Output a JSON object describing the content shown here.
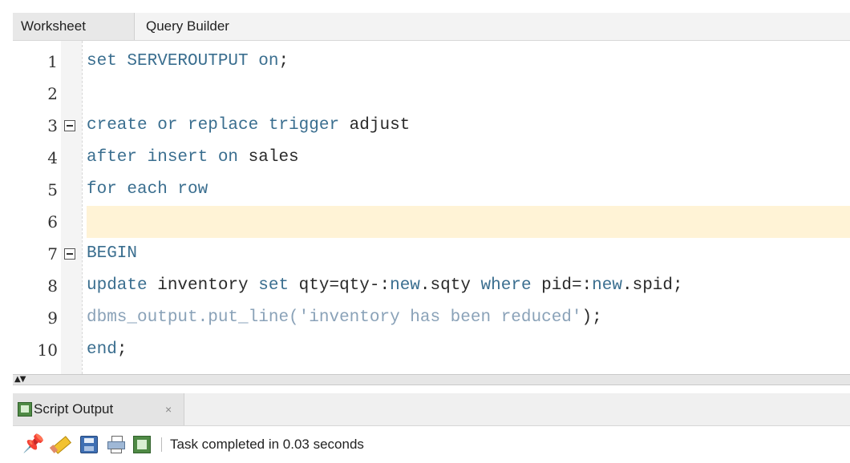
{
  "tabs": {
    "worksheet_label": "Worksheet",
    "query_builder_label": "Query Builder"
  },
  "editor": {
    "lines": [
      {
        "num": "1",
        "segments": [
          {
            "text": "set SERVEROUTPUT on",
            "style": "kw"
          },
          {
            "text": ";",
            "style": "plain"
          }
        ]
      },
      {
        "num": "2",
        "segments": []
      },
      {
        "num": "3",
        "segments": [
          {
            "text": "create or replace trigger",
            "style": "kw"
          },
          {
            "text": " adjust",
            "style": "plain"
          }
        ]
      },
      {
        "num": "4",
        "segments": [
          {
            "text": "after insert on",
            "style": "kw"
          },
          {
            "text": " sales",
            "style": "plain"
          }
        ]
      },
      {
        "num": "5",
        "segments": [
          {
            "text": "for each row",
            "style": "kw"
          }
        ]
      },
      {
        "num": "6",
        "segments": []
      },
      {
        "num": "7",
        "segments": [
          {
            "text": "BEGIN",
            "style": "kw"
          }
        ]
      },
      {
        "num": "8",
        "segments": [
          {
            "text": "update",
            "style": "kw"
          },
          {
            "text": " inventory ",
            "style": "plain"
          },
          {
            "text": "set",
            "style": "kw"
          },
          {
            "text": " qty=qty-:",
            "style": "plain"
          },
          {
            "text": "new",
            "style": "kw"
          },
          {
            "text": ".sqty ",
            "style": "plain"
          },
          {
            "text": "where",
            "style": "kw"
          },
          {
            "text": " pid=:",
            "style": "plain"
          },
          {
            "text": "new",
            "style": "kw"
          },
          {
            "text": ".spid;",
            "style": "plain"
          }
        ]
      },
      {
        "num": "9",
        "segments": [
          {
            "text": "dbms_output.put_line(",
            "style": "gray"
          },
          {
            "text": "'inventory has been reduced'",
            "style": "str"
          },
          {
            "text": ");",
            "style": "plain"
          }
        ]
      },
      {
        "num": "10",
        "segments": [
          {
            "text": "end",
            "style": "kw"
          },
          {
            "text": ";",
            "style": "plain"
          }
        ]
      }
    ],
    "highlighted_line": 6,
    "fold_markers": [
      3,
      7
    ]
  },
  "splitter": {
    "arrows": "▲▼"
  },
  "output": {
    "tab_label": "Script Output",
    "tab_close": "×",
    "status": "Task completed in 0.03 seconds"
  },
  "icons": {
    "pin": "pin-icon",
    "eraser": "eraser-icon",
    "save": "save-icon",
    "print": "print-icon",
    "script": "script-output-icon"
  },
  "colors": {
    "keyword": "#3a6e8f",
    "highlight_row": "#fff3d6",
    "pin": "#c42020"
  }
}
